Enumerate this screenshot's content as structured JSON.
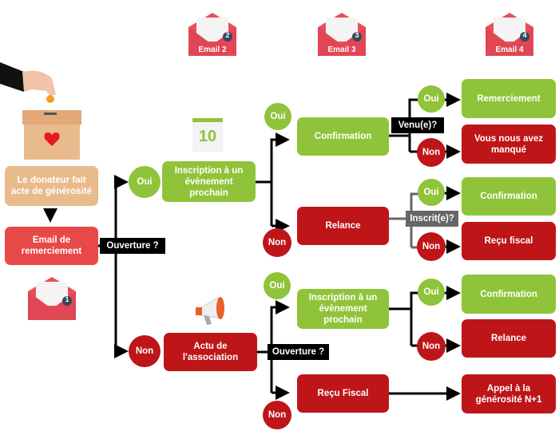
{
  "start": {
    "donor": "Le donateur fait acte de générosité",
    "email1": "Email de remerciement",
    "opening": "Ouverture ?"
  },
  "emails": {
    "e1": "1",
    "e2": "Email 2",
    "e2n": "2",
    "e3": "Email 3",
    "e3n": "3",
    "e4": "Email 4",
    "e4n": "4"
  },
  "branch_yes": {
    "yes": "Oui",
    "box": "Inscription à un évènement prochain",
    "yes2": "Oui",
    "no2": "Non",
    "confirmation": "Confirmation",
    "relance": "Relance",
    "came": "Venu(e)?",
    "came_yes": "Oui",
    "came_no": "Non",
    "thanks": "Remerciement",
    "missed": "Vous nous avez manqué",
    "registered": "Inscrit(e)?",
    "reg_yes": "Oui",
    "reg_no": "Non",
    "reg_confirm": "Confirmation",
    "reg_receipt": "Reçu fiscal"
  },
  "branch_no": {
    "no": "Non",
    "box": "Actu de l'association",
    "opening": "Ouverture ?",
    "yes": "Oui",
    "no2": "Non",
    "event": "Inscription à un évènement prochain",
    "receipt": "Reçu Fiscal",
    "ev_yes": "Oui",
    "ev_no": "Non",
    "ev_confirm": "Confirmation",
    "ev_relance": "Relance",
    "appeal": "Appel à la générosité N+1"
  },
  "calendar": {
    "day": "10"
  },
  "colors": {
    "green": "#8fc43a",
    "red": "#be1519",
    "tan": "#e9ba8c",
    "coral": "#e84848"
  }
}
